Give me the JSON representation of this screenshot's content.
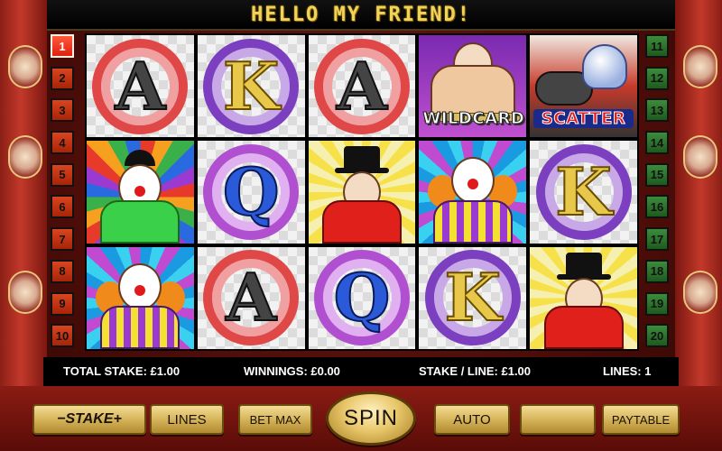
{
  "title": "HELLO MY FRIEND!",
  "paylines_left": [
    "1",
    "2",
    "3",
    "4",
    "5",
    "6",
    "7",
    "8",
    "9",
    "10"
  ],
  "paylines_right": [
    "11",
    "12",
    "13",
    "14",
    "15",
    "16",
    "17",
    "18",
    "19",
    "20"
  ],
  "active_line": "1",
  "reels": {
    "row1": [
      "A",
      "K",
      "A",
      "WILDCARD",
      "SCATTER"
    ],
    "row2": [
      "clown-bowler",
      "Q",
      "ringmaster",
      "clown-orange-hair",
      "K"
    ],
    "row3": [
      "clown-orange-hair",
      "A",
      "Q",
      "K",
      "ringmaster"
    ]
  },
  "symbol_text": {
    "A": "A",
    "K": "K",
    "Q": "Q",
    "wild": "WILDCARD",
    "scatter": "SCATTER"
  },
  "info": {
    "total_stake_label": "TOTAL STAKE: £1.00",
    "winnings_label": "WINNINGS: £0.00",
    "stake_line_label": "STAKE / LINE: £1.00",
    "lines_label": "LINES: 1"
  },
  "buttons": {
    "stake": "−STAKE+",
    "lines": "LINES",
    "bet_max": "BET MAX",
    "spin": "SPIN",
    "auto": "AUTO",
    "blank": "",
    "paytable": "PAYTABLE"
  },
  "colors": {
    "title": "#f2d35a",
    "left_lines": "#c2341a",
    "right_lines": "#2e7a2e",
    "button_gold": "#d6b45a"
  }
}
